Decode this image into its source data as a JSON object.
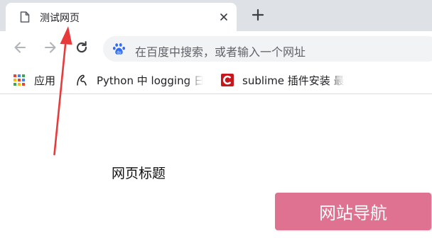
{
  "tab": {
    "title": "测试网页",
    "favicon_icon": "document-icon",
    "close_icon": "close-icon"
  },
  "tabstrip": {
    "new_tab_icon": "plus-icon"
  },
  "toolbar": {
    "back_icon": "arrow-left-icon",
    "forward_icon": "arrow-right-icon",
    "reload_icon": "reload-icon"
  },
  "omnibox": {
    "icon": "baidu-paw-icon",
    "placeholder": "在百度中搜索，或者输入一个网址"
  },
  "bookmarks": [
    {
      "label": "应用",
      "icon": "apps-grid-icon"
    },
    {
      "label": "Python 中 logging 日",
      "icon": "python-logo-icon"
    },
    {
      "label": "sublime 插件安装 最",
      "icon": "csdn-c-icon"
    }
  ],
  "page": {
    "heading": "网页标题",
    "nav_button_label": "网站导航"
  },
  "colors": {
    "tabstrip_bg": "#dee1e6",
    "omnibox_bg": "#f1f3f4",
    "nav_button_bg": "#de7290",
    "annotation_arrow": "#e8393b"
  }
}
